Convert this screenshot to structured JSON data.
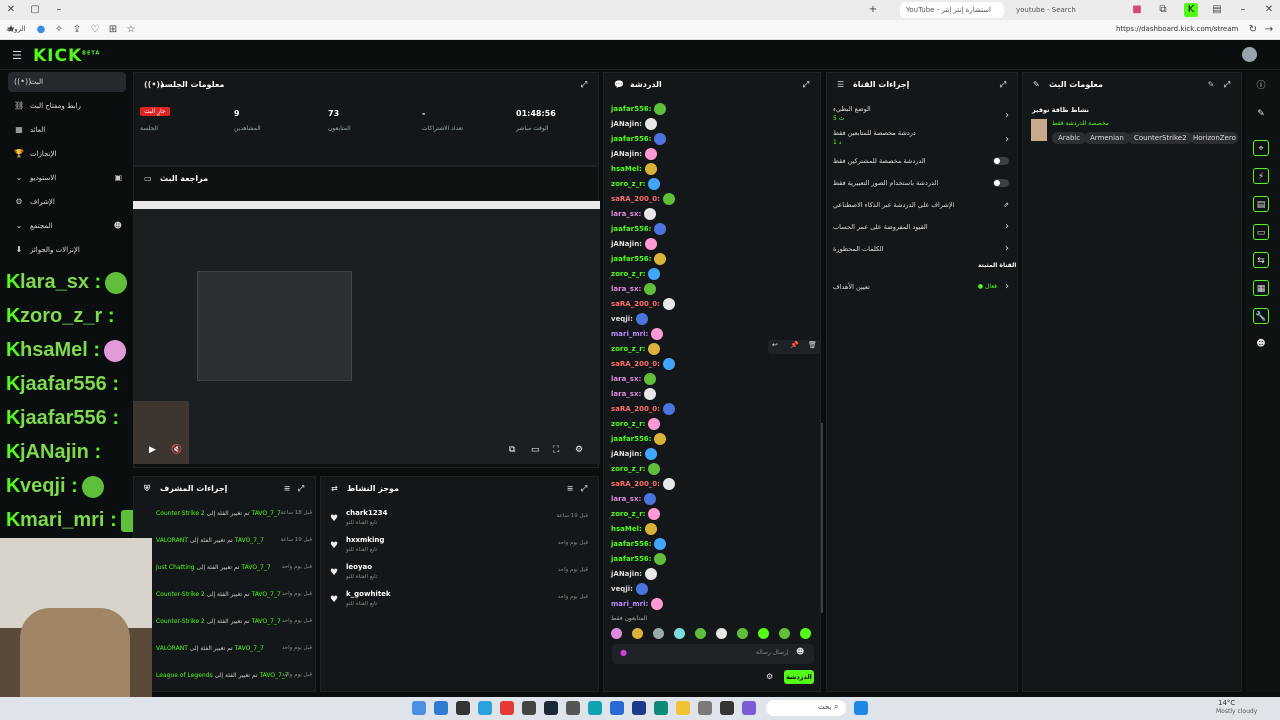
{
  "browser": {
    "tabs": [
      "YouTube - استشارة إنتر إنتر (12)",
      "youtube - Search"
    ],
    "url": "https://dashboard.kick.com/stream",
    "bookmark_label": "الزوجة"
  },
  "kick": {
    "logo": "KICK",
    "beta": "BETA"
  },
  "sidebar": {
    "items": [
      {
        "label": "البث",
        "icon": "live-icon"
      },
      {
        "label": "رابط ومفتاح البث",
        "icon": "link-icon"
      },
      {
        "label": "العائد",
        "icon": "earnings-icon"
      },
      {
        "label": "الإنجازات",
        "icon": "trophy-icon"
      },
      {
        "label": "الاستوديو",
        "icon": "studio-icon"
      },
      {
        "label": "الإشراف",
        "icon": "moderation-icon"
      },
      {
        "label": "المجتمع",
        "icon": "community-icon"
      },
      {
        "label": "الإنزالات والجوائز",
        "icon": "drops-icon"
      }
    ]
  },
  "session": {
    "title": "معلومات الجلسة",
    "badge": "جارٍ البث",
    "stats": [
      {
        "value": "01:48:56",
        "label": "الوقت مباشر"
      },
      {
        "value": "-",
        "label": "تعداد الاشتراكات"
      },
      {
        "value": "73",
        "label": "المتابعون"
      },
      {
        "value": "9",
        "label": "المشاهدين"
      },
      {
        "value": "",
        "label": "الجلسة"
      }
    ]
  },
  "preview": {
    "title": "مراجعة البث"
  },
  "overlay_chat": [
    {
      "user": "lara_sx",
      "sep": ":"
    },
    {
      "user": "zoro_z_r",
      "sep": ":"
    },
    {
      "user": "hsaMel",
      "sep": ":"
    },
    {
      "user": "jaafar556",
      "sep": ":"
    },
    {
      "user": "jaafar556",
      "sep": ":"
    },
    {
      "user": "jANajin",
      "sep": ":"
    },
    {
      "user": "veqji",
      "sep": ":"
    },
    {
      "user": "mari_mri",
      "sep": ":"
    }
  ],
  "chat": {
    "title": "الدردشة",
    "messages": [
      {
        "user": "jaafar556:",
        "color": "#53fc18"
      },
      {
        "user": "jANajin:",
        "color": "#dddddd"
      },
      {
        "user": "jaafar556:",
        "color": "#53fc18"
      },
      {
        "user": "jANajin:",
        "color": "#dddddd"
      },
      {
        "user": "hsaMel:",
        "color": "#53fc18"
      },
      {
        "user": "zoro_z_r:",
        "color": "#53fc18"
      },
      {
        "user": "saRA_200_0:",
        "color": "#ff6b6b"
      },
      {
        "user": "lara_sx:",
        "color": "#e08adf"
      },
      {
        "user": "jaafar556:",
        "color": "#53fc18"
      },
      {
        "user": "jANajin:",
        "color": "#dddddd"
      },
      {
        "user": "jaafar556:",
        "color": "#53fc18"
      },
      {
        "user": "zoro_z_r:",
        "color": "#53fc18"
      },
      {
        "user": "lara_sx:",
        "color": "#e08adf"
      },
      {
        "user": "saRA_200_0:",
        "color": "#ff6b6b"
      },
      {
        "user": "veqji:",
        "color": "#dddddd"
      },
      {
        "user": "mari_mri:",
        "color": "#b98cff"
      },
      {
        "user": "zoro_z_r:",
        "color": "#53fc18"
      },
      {
        "user": "saRA_200_0:",
        "color": "#ff6b6b"
      },
      {
        "user": "lara_sx:",
        "color": "#e08adf"
      },
      {
        "user": "lara_sx:",
        "color": "#e08adf"
      },
      {
        "user": "saRA_200_0:",
        "color": "#ff6b6b"
      },
      {
        "user": "zoro_z_r:",
        "color": "#53fc18"
      },
      {
        "user": "jaafar556:",
        "color": "#53fc18"
      },
      {
        "user": "jANajin:",
        "color": "#dddddd"
      },
      {
        "user": "zoro_z_r:",
        "color": "#53fc18"
      },
      {
        "user": "saRA_200_0:",
        "color": "#ff6b6b"
      },
      {
        "user": "lara_sx:",
        "color": "#e08adf"
      },
      {
        "user": "zoro_z_r:",
        "color": "#53fc18"
      },
      {
        "user": "hsaMel:",
        "color": "#53fc18"
      },
      {
        "user": "jaafar556:",
        "color": "#53fc18"
      },
      {
        "user": "jaafar556:",
        "color": "#53fc18"
      },
      {
        "user": "jANajin:",
        "color": "#dddddd"
      },
      {
        "user": "veqji:",
        "color": "#dddddd"
      },
      {
        "user": "mari_mri:",
        "color": "#b98cff"
      }
    ],
    "followers_label": "المتابعون فقط",
    "input_placeholder": "إرسال رسالة",
    "send_label": "الدردشة"
  },
  "channel_actions": {
    "title": "إجراءات القناة",
    "slow_mode": {
      "label": "الوضع البطيء",
      "value": "5 ث"
    },
    "followers_only": {
      "label": "دردشة مخصصة للمتابعين فقط",
      "value": "1 د"
    },
    "subscribers_only": "الدردشة مخصصة للمشتركين فقط",
    "emotes_only": "الدردشة باستخدام الصور التعبيرية فقط",
    "ai_moderation": "الإشراف على الدردشة عبر الذكاء الاصطناعي",
    "account_age": "القيود المفروضة على عمر الحساب",
    "banned_words": "الكلمات المحظورة",
    "pinned_channel": "القناة المثبتة",
    "set_goals": "تعيين الأهداف",
    "goals_status": "فعال"
  },
  "stream_info": {
    "title": "معلومات البث",
    "stream_title": "نشاط طاقة توقير",
    "category": "مخصصة للدردشة فقط",
    "tags": [
      "Arabic",
      "Armenian",
      "CounterStrike2",
      "HorizonZero"
    ]
  },
  "mod_actions": {
    "title": "إجراءات المشرف",
    "rows": [
      {
        "prefix": "TAVO_7_7",
        "text": "تم تغيير الفئة إلى",
        "game": "Counter-Strike 2",
        "time": "قبل 18 ساعة"
      },
      {
        "prefix": "TAVO_7_7",
        "text": "تم تغيير الفئة إلى",
        "game": "VALORANT",
        "time": "قبل 19 ساعة"
      },
      {
        "prefix": "TAVO_7_7",
        "text": "تم تغيير الفئة إلى",
        "game": "Just Chatting",
        "time": "قبل يوم واحد"
      },
      {
        "prefix": "TAVO_7_7",
        "text": "تم تغيير الفئة إلى",
        "game": "Counter-Strike 2",
        "time": "قبل يوم واحد"
      },
      {
        "prefix": "TAVO_7_7",
        "text": "تم تغيير الفئة إلى",
        "game": "Counter-Strike 2",
        "time": "قبل يوم واحد"
      },
      {
        "prefix": "TAVO_7_7",
        "text": "تم تغيير الفئة إلى",
        "game": "VALORANT",
        "time": "قبل يوم واحد"
      },
      {
        "prefix": "TAVO_7_7",
        "text": "تم تغيير الفئة إلى",
        "game": "League of Legends",
        "time": "قبل يوم واحد"
      }
    ]
  },
  "activity": {
    "title": "موجز النشاط",
    "rows": [
      {
        "user": "chark1234",
        "sub": "تابع القناة للتو",
        "time": "قبل 19 ساعة"
      },
      {
        "user": "hxxmking",
        "sub": "تابع القناة للتو",
        "time": "قبل يوم واحد"
      },
      {
        "user": "leoyao",
        "sub": "تابع القناة للتو",
        "time": "قبل يوم واحد"
      },
      {
        "user": "k_gowhitek",
        "sub": "تابع القناة للتو",
        "time": "قبل يوم واحد"
      }
    ]
  },
  "taskbar": {
    "search": "بحث",
    "weather_temp": "14°C",
    "weather_desc": "Mostly cloudy"
  },
  "colors": {
    "accent": "#53fc18",
    "panel": "#141719",
    "bg": "#0b0e0f"
  }
}
